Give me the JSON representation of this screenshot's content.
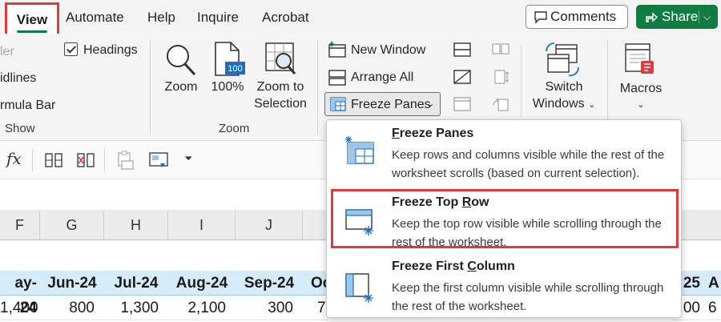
{
  "tabs": {
    "view": "View",
    "automate": "Automate",
    "help": "Help",
    "inquire": "Inquire",
    "acrobat": "Acrobat"
  },
  "actions": {
    "comments": "Comments",
    "share": "Share"
  },
  "ribbon": {
    "show": {
      "ruler_partial": "ler",
      "gridlines_partial": "idlines",
      "formula_bar_partial": "rmula Bar",
      "headings": "Headings",
      "label": "Show"
    },
    "zoom": {
      "zoom": "Zoom",
      "zoom100": "100%",
      "zoom_to_selection_1": "Zoom to",
      "zoom_to_selection_2": "Selection",
      "label": "Zoom",
      "badge": "100"
    },
    "window": {
      "new_window": "New Window",
      "arrange_all": "Arrange All",
      "freeze_panes": "Freeze Panes",
      "switch_windows_1": "Switch",
      "switch_windows_2": "Windows"
    },
    "macros": {
      "label": "Macros"
    }
  },
  "formula_bar": {
    "fx": "fx"
  },
  "sheet": {
    "columns": [
      "F",
      "G",
      "H",
      "I",
      "J"
    ],
    "header_row": [
      "ay-24",
      "Jun-24",
      "Jul-24",
      "Aug-24",
      "Sep-24",
      "Oc"
    ],
    "data_row": [
      "1,400",
      "800",
      "1,300",
      "2,100",
      "300",
      "7"
    ],
    "right_header_partial": [
      "25",
      "A"
    ],
    "right_data_partial": [
      "00",
      "6"
    ]
  },
  "freeze_menu": {
    "items": [
      {
        "title_prefix": "",
        "title_ul": "F",
        "title_rest": "reeze Panes",
        "desc": "Keep rows and columns visible while the rest of the worksheet scrolls (based on current selection)."
      },
      {
        "title_prefix": "Freeze Top ",
        "title_ul": "R",
        "title_rest": "ow",
        "desc": "Keep the top row visible while scrolling through the rest of the worksheet."
      },
      {
        "title_prefix": "Freeze First ",
        "title_ul": "C",
        "title_rest": "olumn",
        "desc": "Keep the first column visible while scrolling through the rest of the worksheet."
      }
    ]
  },
  "colors": {
    "accent_green": "#107c41",
    "highlight_red": "#e0393e",
    "header_fill": "#d7ecf9"
  }
}
